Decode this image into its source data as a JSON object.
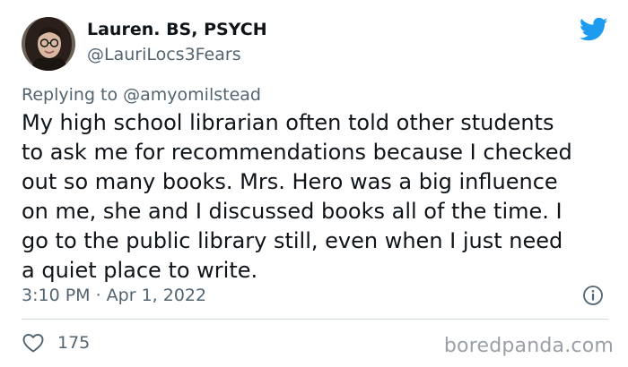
{
  "author": {
    "display_name": "Lauren. BS, PSYCH",
    "handle": "@LauriLocs3Fears"
  },
  "reply": {
    "prefix": "Replying to ",
    "mention": "@amyomilstead"
  },
  "tweet": {
    "lines": [
      "My high school librarian often told other students",
      "to ask me for recommendations because I checked",
      "out so many books. Mrs. Hero was a big influence",
      "on me, she and I discussed books all of the time. I",
      "go to the public library still, even when I just need",
      "a quiet place to write."
    ],
    "timestamp": "3:10 PM · Apr 1, 2022"
  },
  "stats": {
    "likes": "175"
  },
  "watermark": "boredpanda.com",
  "icons": {
    "brand": "twitter-bird-icon",
    "info": "info-icon",
    "like": "heart-icon"
  },
  "colors": {
    "twitter_blue": "#1d9bf0",
    "secondary_text": "#536471",
    "primary_text": "#0f1419"
  }
}
